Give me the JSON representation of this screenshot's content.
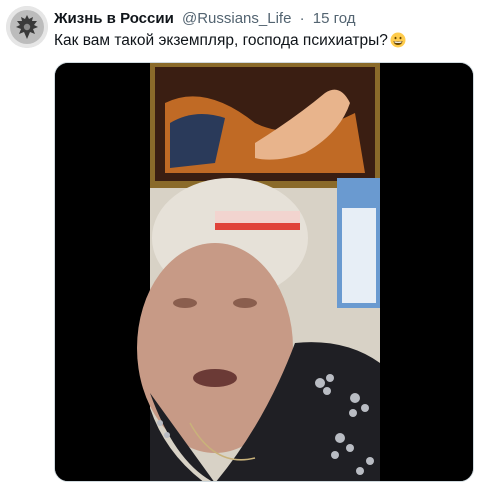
{
  "tweet": {
    "display_name": "Жизнь в России",
    "handle": "@Russians_Life",
    "separator": "·",
    "time": "15 год",
    "text": "Как вам такой экземпляр, господа психиатры?",
    "emoji_icon": "grinning-face-icon",
    "avatar_icon": "double-headed-eagle-icon"
  },
  "media": {
    "type": "video-still",
    "description_icon": "video-frame-icon"
  },
  "colors": {
    "text_primary": "#0f1419",
    "text_secondary": "#536471",
    "media_background": "#000000"
  }
}
